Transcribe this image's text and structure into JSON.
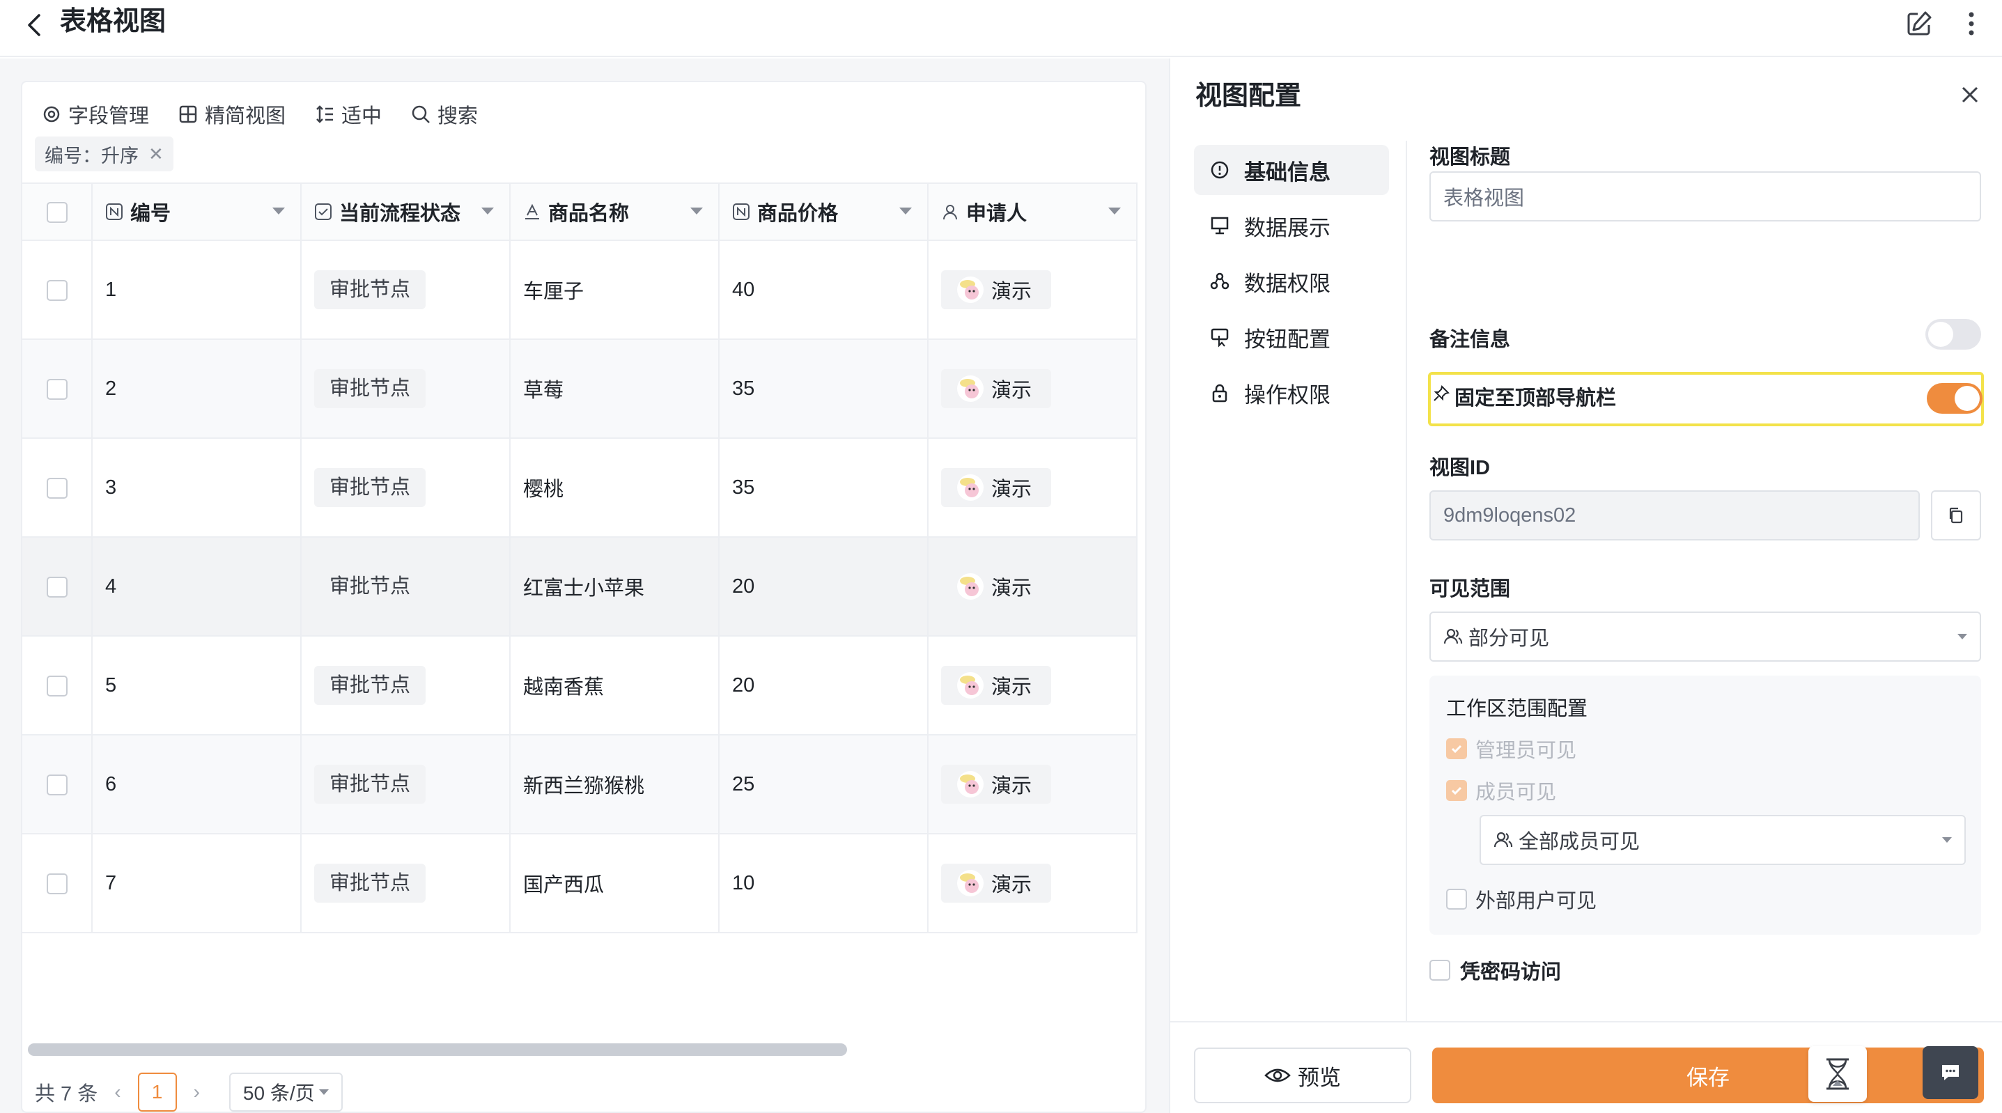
{
  "header": {
    "title": "表格视图"
  },
  "toolbar": {
    "fields": "字段管理",
    "compact": "精简视图",
    "density": "适中",
    "search": "搜索"
  },
  "sort_chip": "编号：升序",
  "table": {
    "columns": [
      "编号",
      "当前流程状态",
      "商品名称",
      "商品价格",
      "申请人"
    ],
    "rows": [
      {
        "id": "1",
        "status": "审批节点",
        "name": "车厘子",
        "price": "40",
        "applicant": "演示"
      },
      {
        "id": "2",
        "status": "审批节点",
        "name": "草莓",
        "price": "35",
        "applicant": "演示"
      },
      {
        "id": "3",
        "status": "审批节点",
        "name": "樱桃",
        "price": "35",
        "applicant": "演示"
      },
      {
        "id": "4",
        "status": "审批节点",
        "name": "红富士小苹果",
        "price": "20",
        "applicant": "演示"
      },
      {
        "id": "5",
        "status": "审批节点",
        "name": "越南香蕉",
        "price": "20",
        "applicant": "演示"
      },
      {
        "id": "6",
        "status": "审批节点",
        "name": "新西兰猕猴桃",
        "price": "25",
        "applicant": "演示"
      },
      {
        "id": "7",
        "status": "审批节点",
        "name": "国产西瓜",
        "price": "10",
        "applicant": "演示"
      }
    ]
  },
  "pagination": {
    "total": "共 7 条",
    "current": "1",
    "page_size": "50 条/页"
  },
  "panel": {
    "title": "视图配置",
    "nav": [
      "基础信息",
      "数据展示",
      "数据权限",
      "按钮配置",
      "操作权限"
    ],
    "view_title_label": "视图标题",
    "view_title_placeholder": "表格视图",
    "remark_label": "备注信息",
    "remark_enabled": false,
    "pin_label": "固定至顶部导航栏",
    "pin_enabled": true,
    "view_id_label": "视图ID",
    "view_id_value": "9dm9loqens02",
    "visibility_label": "可见范围",
    "visibility_value": "部分可见",
    "workspace_label": "工作区范围配置",
    "admin_visible": "管理员可见",
    "member_visible": "成员可见",
    "member_scope": "全部成员可见",
    "external_visible": "外部用户可见",
    "password_access": "凭密码访问",
    "preview_button": "预览",
    "save_button": "保存"
  },
  "colors": {
    "accent": "#ef8c3e",
    "highlight": "#f3e24a"
  }
}
